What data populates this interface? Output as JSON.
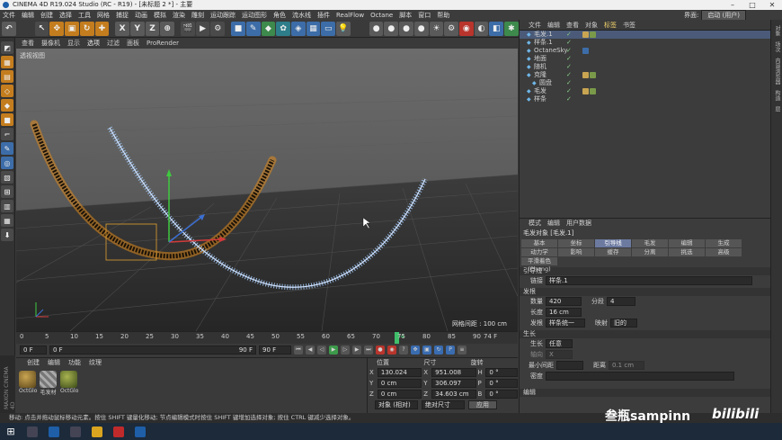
{
  "window": {
    "title": "CINEMA 4D R19.024 Studio (RC - R19) - [未标题 2 *] - 主要"
  },
  "menu": {
    "items": [
      "文件",
      "编辑",
      "创建",
      "选择",
      "工具",
      "网格",
      "捕捉",
      "动画",
      "模拟",
      "渲染",
      "雕刻",
      "运动跟踪",
      "运动图形",
      "角色",
      "流水线",
      "插件",
      "RealFlow",
      "Octane",
      "脚本",
      "窗口",
      "帮助"
    ],
    "interface_label": "界面:",
    "interface_value": "启动 (用户)"
  },
  "viewport": {
    "menu": [
      "查看",
      "摄像机",
      "显示",
      "选项",
      "过滤",
      "面板",
      "ProRender"
    ],
    "label": "透视视图",
    "grid_info": "网格间距 : 100 cm"
  },
  "timeline": {
    "ticks": [
      "0",
      "5",
      "10",
      "15",
      "20",
      "25",
      "30",
      "35",
      "40",
      "45",
      "50",
      "55",
      "60",
      "65",
      "70",
      "75",
      "80",
      "85",
      "90"
    ],
    "current": "74",
    "end_label": "74 F"
  },
  "playback": {
    "start": "0 F",
    "range_start": "0 F",
    "range_end": "90 F",
    "end": "90 F"
  },
  "materials": {
    "tabs": [
      "创建",
      "编辑",
      "功能",
      "纹理"
    ],
    "items": [
      "OctGlo",
      "毛发材",
      "OctGlo"
    ]
  },
  "coords": {
    "headers": [
      "位置",
      "尺寸",
      "旋转"
    ],
    "rows": [
      {
        "axis": "X",
        "pos": "130.024 cm",
        "size": "951.008 cm",
        "rot_axis": "H",
        "rot": "0 °"
      },
      {
        "axis": "Y",
        "pos": "0 cm",
        "size": "306.097 cm",
        "rot_axis": "P",
        "rot": "0 °"
      },
      {
        "axis": "Z",
        "pos": "0 cm",
        "size": "34.603 cm",
        "rot_axis": "B",
        "rot": "0 °"
      }
    ],
    "mode": "对象 (相对)",
    "size_mode": "绝对尺寸",
    "apply": "应用"
  },
  "objects": {
    "menu": [
      "文件",
      "编辑",
      "查看",
      "对象",
      "标签",
      "书签"
    ],
    "rows": [
      {
        "name": "毛发.1",
        "sel": true
      },
      {
        "name": "样条.1",
        "sel": false
      },
      {
        "name": "OctaneSky",
        "sel": false
      },
      {
        "name": "地面",
        "sel": false
      },
      {
        "name": "随机",
        "sel": false
      },
      {
        "name": "克隆",
        "sel": false
      },
      {
        "name": "圆盘",
        "sel": false
      },
      {
        "name": "毛发",
        "sel": false
      },
      {
        "name": "样条",
        "sel": false
      }
    ]
  },
  "attributes": {
    "menu": [
      "模式",
      "编辑",
      "用户数据"
    ],
    "title": "毛发对象 [毛发.1]",
    "tabs": [
      "基本",
      "坐标",
      "引导线",
      "毛发",
      "编辑",
      "生成",
      "动力学",
      "影响",
      "缓存",
      "分离",
      "挑选",
      "高级",
      "平滑着色(Phong)"
    ],
    "active_tab": "引导线",
    "section1": "引导线",
    "link_label": "链接",
    "link_value": "样条.1",
    "section2": "发根",
    "count_label": "数量",
    "count_value": "420",
    "seg_label": "分段",
    "seg_value": "4",
    "len_label": "长度",
    "len_value": "16 cm",
    "root_label": "发根",
    "root_value": "样条统一",
    "map_label": "映射",
    "map_value": "旧的",
    "section3": "生长",
    "grow_label": "生长",
    "grow_value": "任意",
    "axis_label": "轴向",
    "axis_value": "X",
    "min_label": "最小间距",
    "dist_label": "距离",
    "dist_value": "0.1 cm",
    "density_label": "密度",
    "edit_section": "编辑"
  },
  "statusbar": "移动: 点击并拖动鼠标移动元素。按住 SHIFT 键量化移动; 节点编辑模式时按住 SHIFT 键增加选择对象; 按住 CTRL 键减少选择对象。",
  "watermark": {
    "text": "叁瓶sampinn",
    "logo": "bilibili"
  },
  "right_tabs": [
    "对象",
    "场次",
    "内容浏览器",
    "构造",
    "层"
  ],
  "logo_text": "MAXON CINEMA 4D"
}
